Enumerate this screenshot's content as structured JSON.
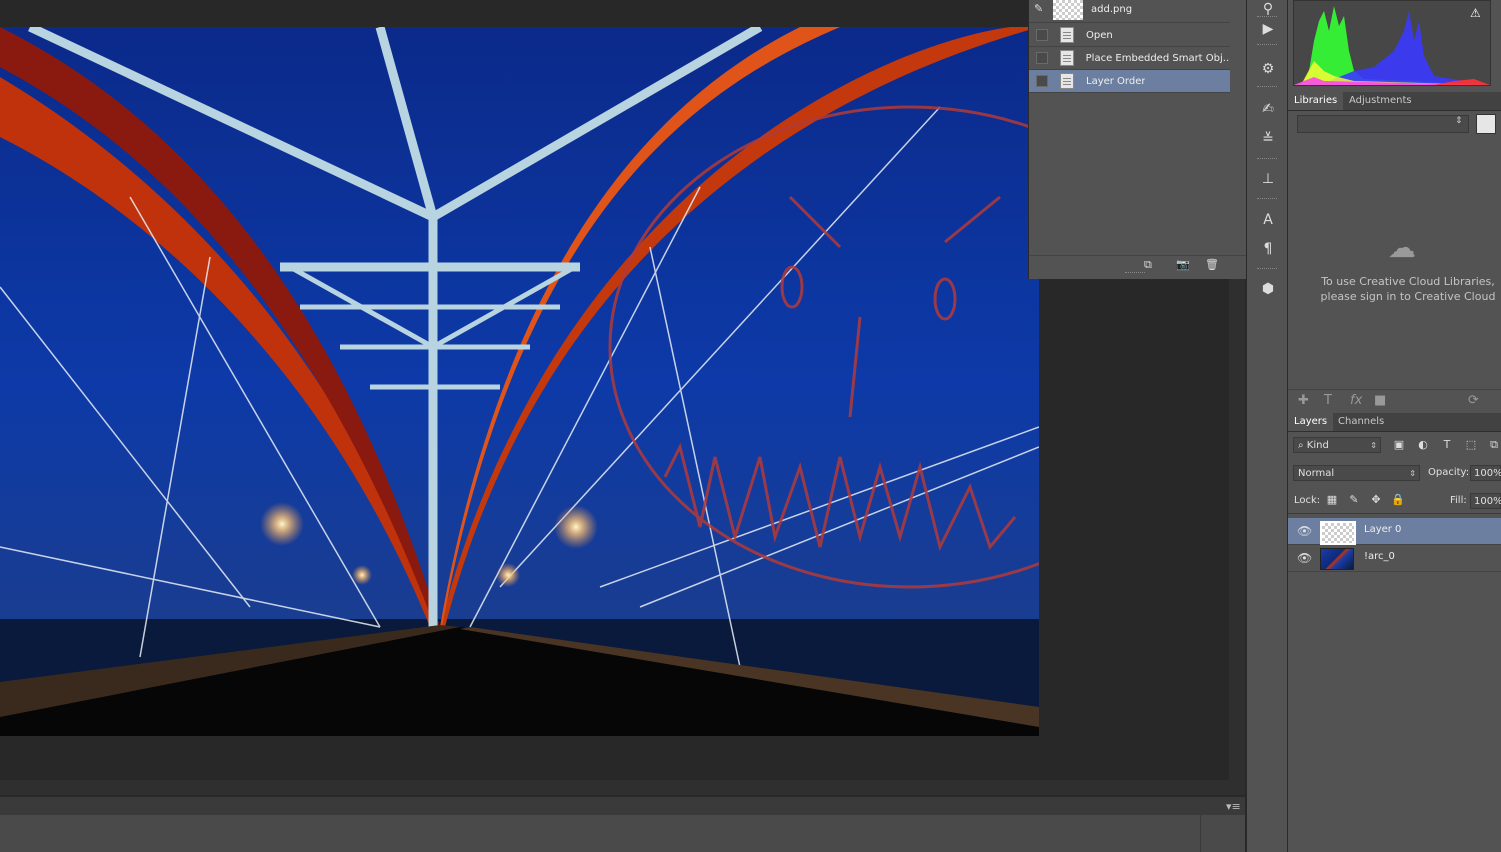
{
  "history": {
    "snapshot_label": "add.png",
    "items": [
      {
        "label": "Open"
      },
      {
        "label": "Place Embedded Smart Obj..."
      },
      {
        "label": "Layer Order"
      }
    ]
  },
  "libraries": {
    "tabs": [
      "Libraries",
      "Adjustments"
    ],
    "message_line1": "To use Creative Cloud Libraries,",
    "message_line2": "please sign in to Creative Cloud"
  },
  "layers": {
    "tabs": [
      "Layers",
      "Channels"
    ],
    "filter_kind": "Kind",
    "blend_mode": "Normal",
    "opacity_label": "Opacity:",
    "opacity_value": "100%",
    "lock_label": "Lock:",
    "fill_label": "Fill:",
    "fill_value": "100%",
    "items": [
      {
        "name": "Layer 0",
        "selected": true
      },
      {
        "name": "!arc_0",
        "selected": false
      }
    ]
  },
  "colors": {
    "selection": "#6d7fa0",
    "panel": "#535353",
    "workspace": "#282828",
    "annotation": "#b23a3a"
  }
}
